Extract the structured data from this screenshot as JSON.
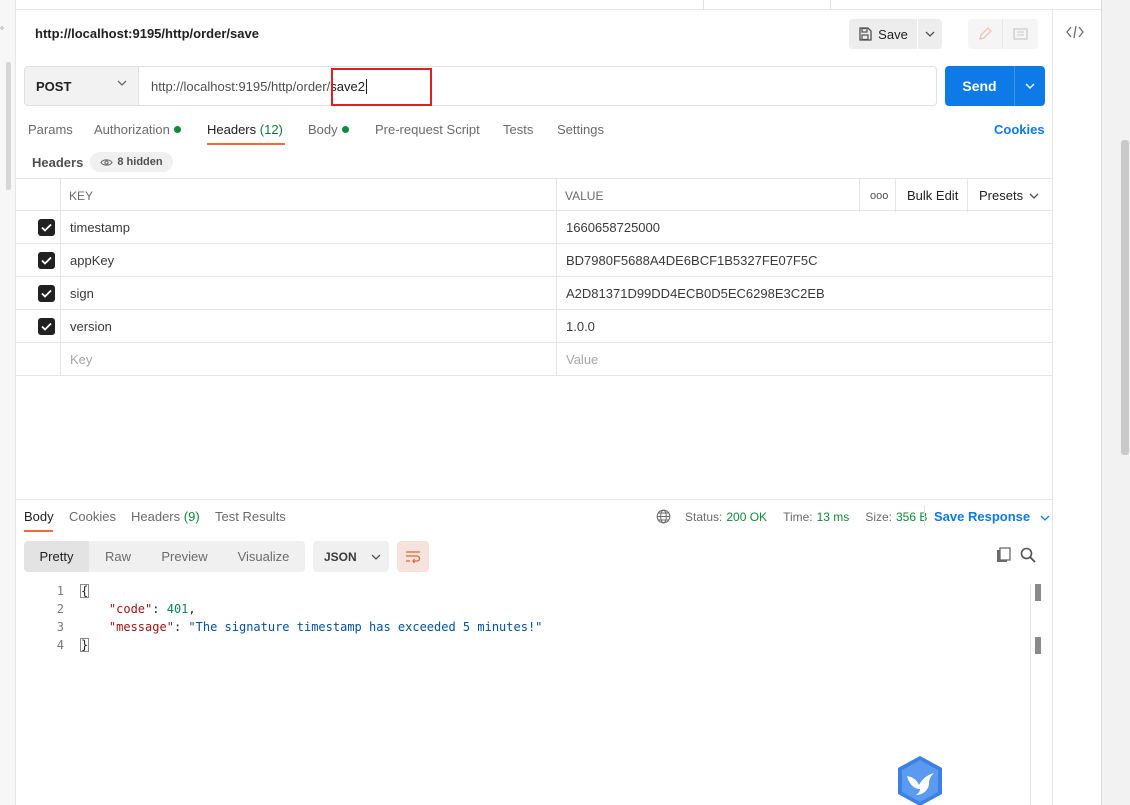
{
  "tab_title": "http://localhost:9195/http/order/save",
  "toolbar": {
    "save_label": "Save"
  },
  "request": {
    "method": "POST",
    "url_base": "http://localhost:9195/http/order/",
    "url_edited": "save2",
    "send_label": "Send"
  },
  "request_tabs": [
    {
      "label": "Params"
    },
    {
      "label": "Authorization"
    },
    {
      "label": "Headers",
      "count": "(12)"
    },
    {
      "label": "Body"
    },
    {
      "label": "Pre-request Script"
    },
    {
      "label": "Tests"
    },
    {
      "label": "Settings"
    }
  ],
  "cookies_label": "Cookies",
  "headers_section": {
    "label": "Headers",
    "hidden": "8 hidden"
  },
  "table": {
    "col_key": "KEY",
    "col_value": "VALUE",
    "more": "ooo",
    "bulk_edit": "Bulk Edit",
    "presets": "Presets",
    "rows": [
      {
        "key": "timestamp",
        "value": "1660658725000"
      },
      {
        "key": "appKey",
        "value": "BD7980F5688A4DE6BCF1B5327FE07F5C"
      },
      {
        "key": "sign",
        "value": "A2D81371D99DD4ECB0D5EC6298E3C2EB"
      },
      {
        "key": "version",
        "value": "1.0.0"
      }
    ],
    "key_placeholder": "Key",
    "value_placeholder": "Value"
  },
  "response": {
    "tabs": [
      {
        "label": "Body"
      },
      {
        "label": "Cookies"
      },
      {
        "label": "Headers",
        "count": "(9)"
      },
      {
        "label": "Test Results"
      }
    ],
    "status_label": "Status:",
    "status_value": "200 OK",
    "time_label": "Time:",
    "time_value": "13 ms",
    "size_label": "Size:",
    "size_value": "356 B",
    "save_response": "Save Response",
    "views": [
      "Pretty",
      "Raw",
      "Preview",
      "Visualize"
    ],
    "format": "JSON",
    "lines": [
      "1",
      "2",
      "3",
      "4"
    ],
    "body": {
      "open": "{",
      "code_key": "\"code\"",
      "code_val": "401",
      "message_key": "\"message\"",
      "message_val": "\"The signature timestamp has exceeded 5 minutes!\"",
      "close": "}"
    }
  },
  "colors": {
    "accent": "#0d7ae8",
    "tab_underline": "#f26b3a",
    "highlight_box": "#e02020",
    "status_green": "#0f8a3a"
  }
}
